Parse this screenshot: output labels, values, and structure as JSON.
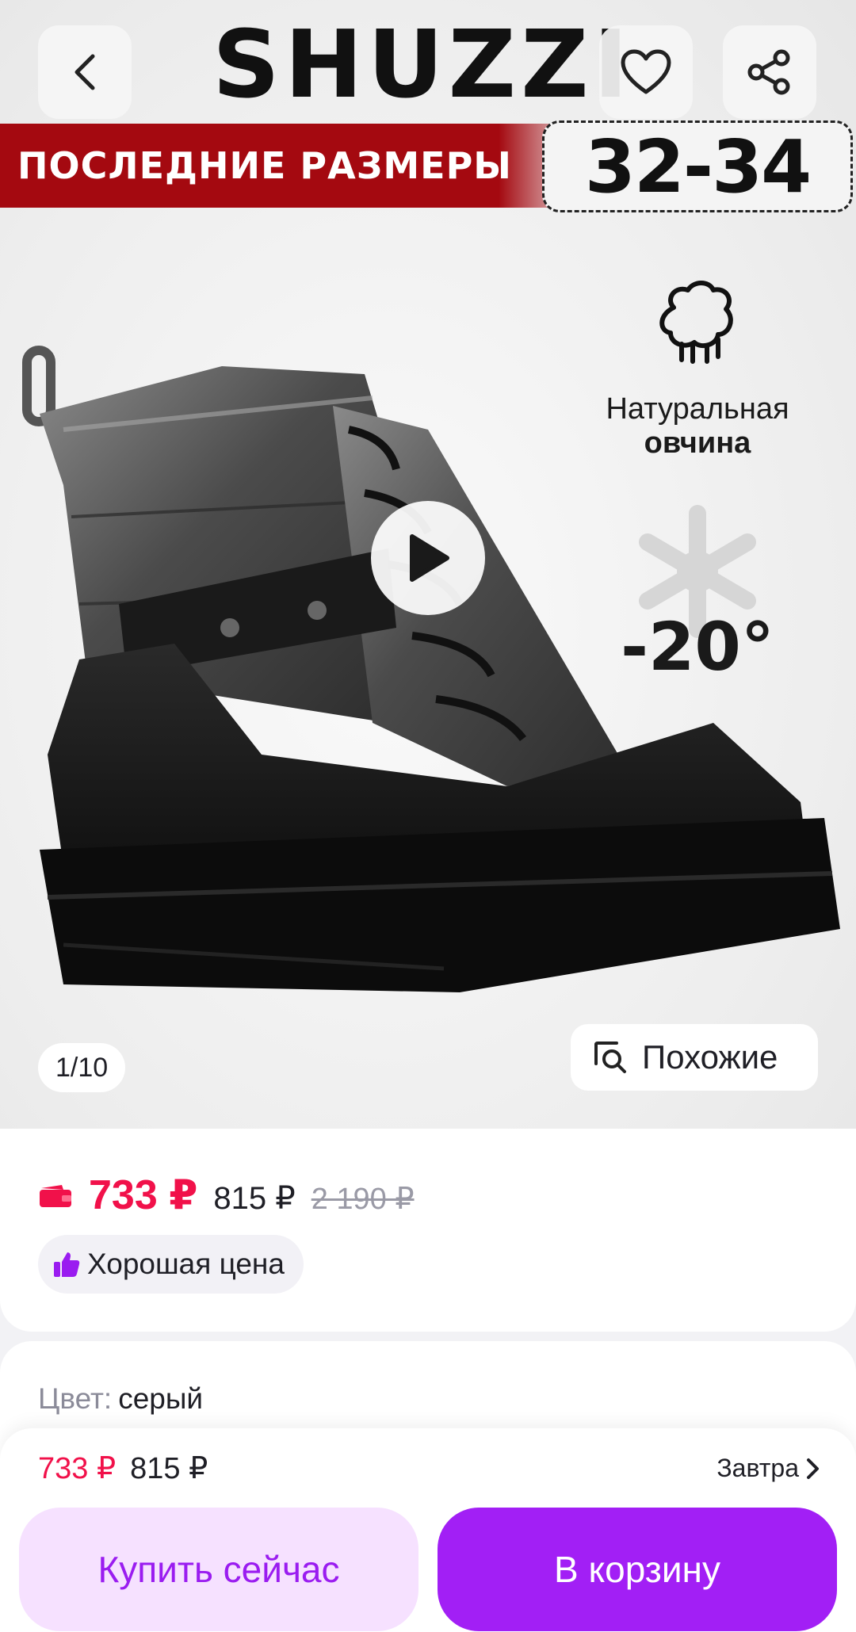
{
  "gallery": {
    "brand": "SHUZZI",
    "banner_text": "ПОСЛЕДНИЕ РАЗМЕРЫ",
    "sizes": "32-34",
    "feature_line1": "Натуральная",
    "feature_line2": "овчина",
    "temperature": "-20°",
    "counter": "1/10",
    "similar_label": "Похожие"
  },
  "price": {
    "main": "733 ₽",
    "second": "815 ₽",
    "old": "2 190 ₽",
    "badge": "Хорошая цена"
  },
  "color": {
    "label": "Цвет:",
    "value": "серый"
  },
  "bottom_bar": {
    "price_main": "733 ₽",
    "price_second": "815 ₽",
    "delivery": "Завтра",
    "buy_now": "Купить сейчас",
    "add_to_cart": "В корзину"
  },
  "colors": {
    "accent_purple": "#a21ff5",
    "buy_now_bg": "#f6e1ff",
    "price_red": "#f1114a",
    "banner_red": "#a40910"
  },
  "icons": [
    "back-arrow-icon",
    "heart-icon",
    "share-icon",
    "sheep-icon",
    "snowflake-icon",
    "play-icon",
    "image-search-icon",
    "wallet-icon",
    "thumbs-up-icon",
    "chevron-right-icon"
  ]
}
